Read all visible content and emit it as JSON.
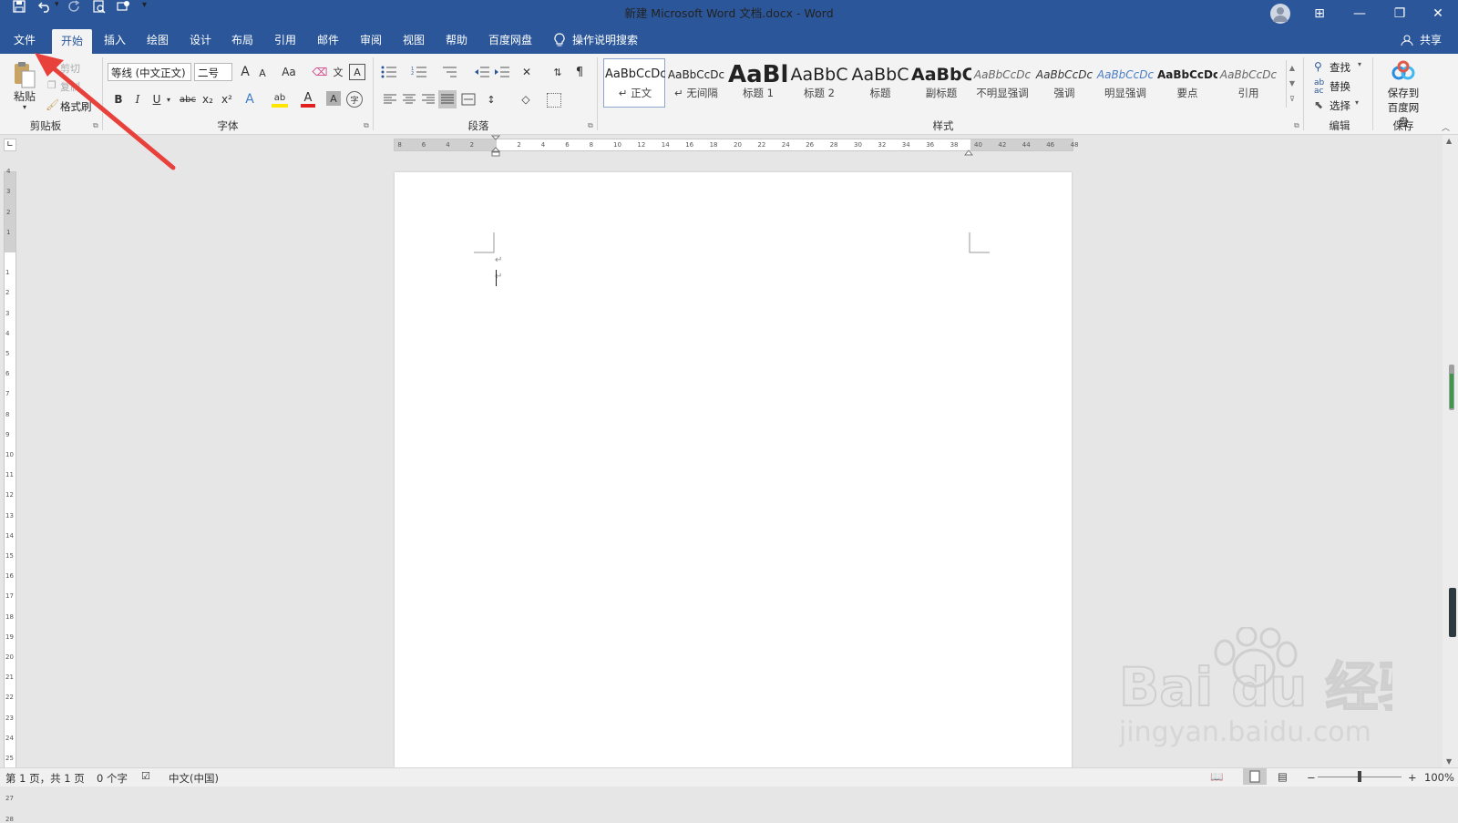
{
  "window": {
    "title": "新建 Microsoft Word 文档.docx  -  Word",
    "controls": {
      "minimize": "—",
      "restore": "❐",
      "close": "✕",
      "ribbon_display": "⊞"
    }
  },
  "quick_access": {
    "save_icon": "save-icon",
    "undo_icon": "undo-icon",
    "redo_icon": "redo-icon",
    "print_preview_icon": "print-preview-icon",
    "customize": "▾"
  },
  "menu": {
    "tabs": [
      "文件",
      "开始",
      "插入",
      "绘图",
      "设计",
      "布局",
      "引用",
      "邮件",
      "审阅",
      "视图",
      "帮助",
      "百度网盘"
    ],
    "active_tab": "开始",
    "tell_me": "操作说明搜索",
    "share": "共享"
  },
  "clipboard": {
    "paste": "粘贴",
    "cut": "剪切",
    "copy": "复制",
    "format_painter": "格式刷",
    "group_label": "剪贴板"
  },
  "font": {
    "font_name": "等线 (中文正文)",
    "font_size": "二号",
    "grow": "A",
    "shrink": "A",
    "change_case": "Aa",
    "bold": "B",
    "italic": "I",
    "underline": "U",
    "strikethrough": "abc",
    "subscript": "x₂",
    "superscript": "x²",
    "highlight": "ab",
    "color": "A",
    "shade": "A",
    "group_label": "字体"
  },
  "paragraph": {
    "group_label": "段落"
  },
  "styles": {
    "items": [
      {
        "sample": "AaBbCcDc",
        "name": "↵ 正文"
      },
      {
        "sample": "AaBbCcDc",
        "name": "↵ 无间隔"
      },
      {
        "sample": "AaBl",
        "name": "标题 1"
      },
      {
        "sample": "AaBbC",
        "name": "标题 2"
      },
      {
        "sample": "AaBbC",
        "name": "标题"
      },
      {
        "sample": "AaBbC",
        "name": "副标题"
      },
      {
        "sample": "AaBbCcDc",
        "name": "不明显强调"
      },
      {
        "sample": "AaBbCcDc",
        "name": "强调"
      },
      {
        "sample": "AaBbCcDc",
        "name": "明显强调"
      },
      {
        "sample": "AaBbCcDc",
        "name": "要点"
      },
      {
        "sample": "AaBbCcDc",
        "name": "引用"
      }
    ],
    "group_label": "样式"
  },
  "editing": {
    "find": "查找",
    "replace": "替换",
    "select": "选择",
    "group_label": "编辑"
  },
  "save_group": {
    "save_to_baidu": "保存到",
    "save_to_baidu_2": "百度网盘",
    "group_label": "保存"
  },
  "ruler": {
    "h_left": [
      "8",
      "6",
      "4",
      "2"
    ],
    "h_right": [
      "2",
      "4",
      "6",
      "8",
      "10",
      "12",
      "14",
      "16",
      "18",
      "20",
      "22",
      "24",
      "26",
      "28",
      "30",
      "32",
      "34",
      "36",
      "38",
      "40",
      "42",
      "44",
      "46",
      "48"
    ],
    "v_top": [
      "4",
      "3",
      "2",
      "1"
    ],
    "v_down": [
      "1",
      "2",
      "3",
      "4",
      "5",
      "6",
      "7",
      "8",
      "9",
      "10",
      "11",
      "12",
      "13",
      "14",
      "15",
      "16",
      "17",
      "18",
      "19",
      "20",
      "21",
      "22",
      "23",
      "24",
      "25",
      "26",
      "27",
      "28"
    ]
  },
  "document": {
    "paragraph_mark": "↵"
  },
  "status": {
    "page": "第 1 页，共 1 页",
    "words": "0 个字",
    "language": "中文(中国)",
    "zoom": "100%",
    "zoom_minus": "−",
    "zoom_plus": "+"
  },
  "watermark": {
    "brand": "Bai du 经验",
    "url": "jingyan.baidu.com"
  },
  "colors": {
    "accent": "#2b579a",
    "arrow": "#e8413c"
  }
}
